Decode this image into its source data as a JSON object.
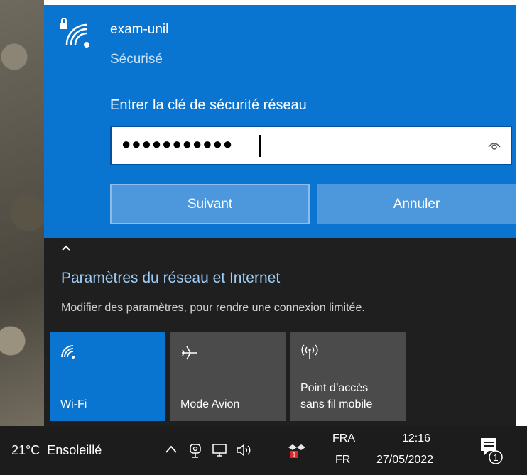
{
  "network": {
    "ssid": "exam-unil",
    "status": "Sécurisé",
    "key_label": "Entrer la clé de sécurité réseau",
    "key_masked": "●●●●●●●●●●●",
    "next_label": "Suivant",
    "cancel_label": "Annuler"
  },
  "settings": {
    "title": "Paramètres du réseau et Internet",
    "subtitle": "Modifier des paramètres, pour rendre une connexion limitée."
  },
  "tiles": [
    {
      "label": "Wi-Fi",
      "icon": "wifi-icon",
      "active": true
    },
    {
      "label": "Mode Avion",
      "icon": "airplane-icon",
      "active": false
    },
    {
      "label_line1": "Point d’accès",
      "label_line2": "sans fil mobile",
      "icon": "hotspot-icon",
      "active": false
    }
  ],
  "taskbar": {
    "weather": "21°C  Ensoleillé",
    "lang_top": "FRA",
    "lang_bottom": "FR",
    "time": "12:16",
    "date": "27/05/2022",
    "notifications": "1"
  },
  "colors": {
    "accent": "#0a74d1",
    "flyout_bg": "#1f1f1f",
    "tile_bg": "#4b4b4b",
    "link": "#9dcdf6",
    "taskbar_bg": "#1c1c1c"
  }
}
